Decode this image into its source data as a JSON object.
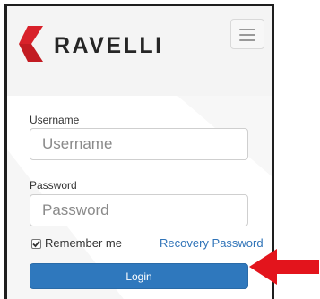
{
  "brand": {
    "name": "RAVELLI",
    "logo_icon": "ravelli-logo-icon",
    "accent_color": "#d8212a"
  },
  "header": {
    "menu_icon": "hamburger-menu-icon"
  },
  "form": {
    "username_label": "Username",
    "username_placeholder": "Username",
    "username_value": "",
    "password_label": "Password",
    "password_placeholder": "Password",
    "password_value": "",
    "remember_label": "Remember me",
    "remember_checked": true,
    "recovery_link": "Recovery Password",
    "login_label": "Login",
    "login_color": "#2f78bd"
  },
  "annotation": {
    "arrow_icon": "red-arrow-icon",
    "arrow_color": "#e3141c"
  }
}
